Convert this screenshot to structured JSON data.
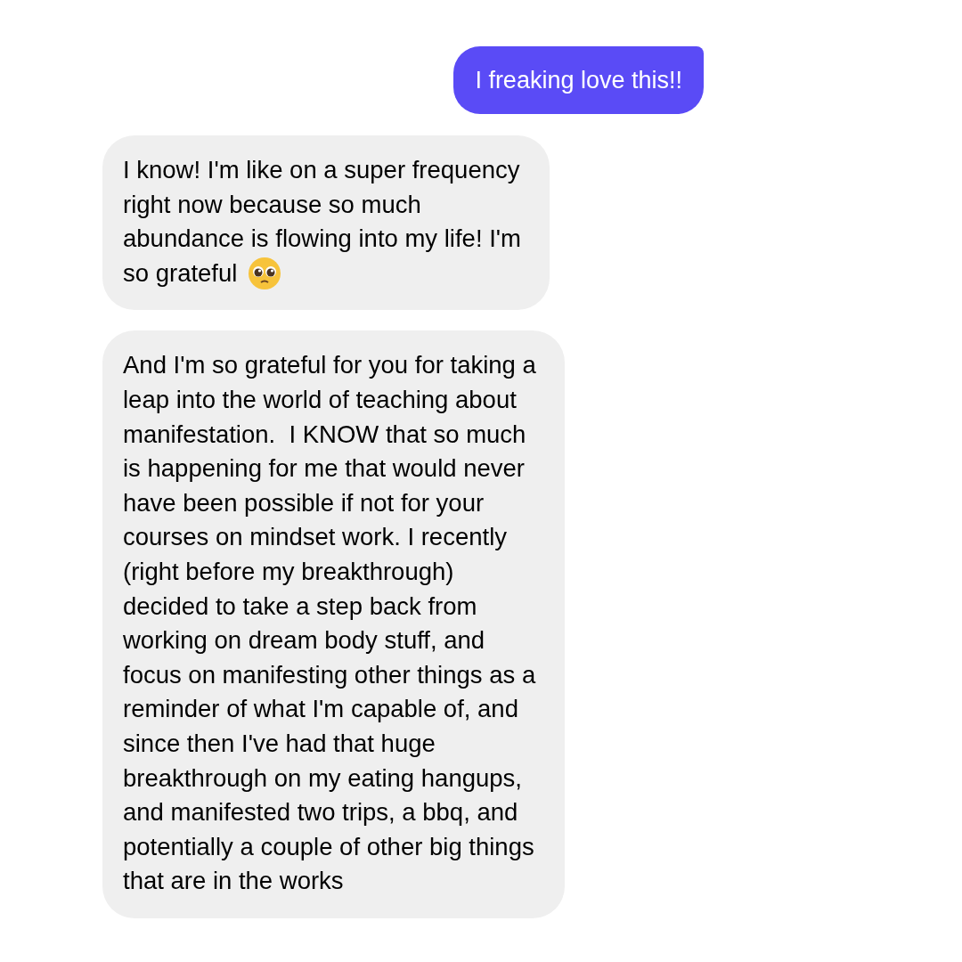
{
  "messages": [
    {
      "kind": "sent",
      "text": "I freaking love this!!"
    },
    {
      "kind": "received",
      "text": "I know! I'm like on a super frequency\nright now because so much\nabundance is flowing into my life! I'm\nso grateful",
      "emoji": true
    },
    {
      "kind": "received",
      "text": "And I'm so grateful for you for taking a\nleap into the world of teaching about\nmanifestation.  I KNOW that so much\nis happening for me that would never\nhave been possible if not for your\ncourses on mindset work. I recently\n(right before my breakthrough)\ndecided to take a step back from\nworking on dream body stuff, and\nfocus on manifesting other things as a\nreminder of what I'm capable of, and\nsince then I've had that huge\nbreakthrough on my eating hangups,\nand manifested two trips, a bbq, and\npotentially a couple of other big things\nthat are in the works",
      "emoji": false
    }
  ]
}
